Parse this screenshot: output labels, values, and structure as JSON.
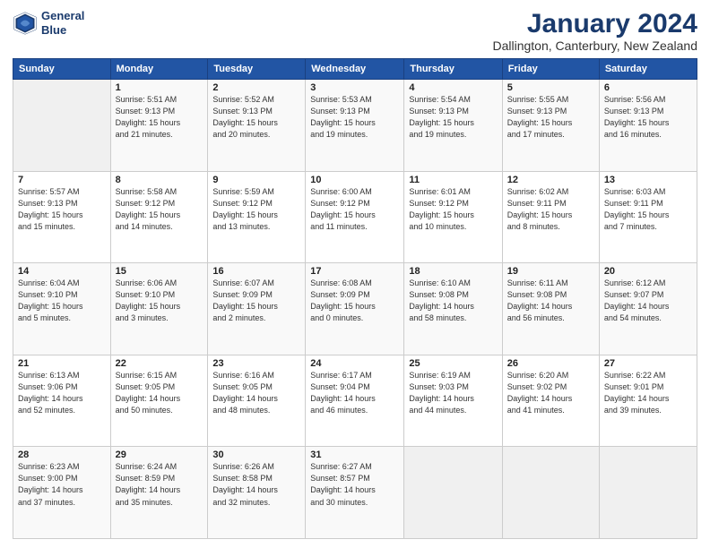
{
  "header": {
    "logo_line1": "General",
    "logo_line2": "Blue",
    "title": "January 2024",
    "subtitle": "Dallington, Canterbury, New Zealand"
  },
  "calendar": {
    "days_of_week": [
      "Sunday",
      "Monday",
      "Tuesday",
      "Wednesday",
      "Thursday",
      "Friday",
      "Saturday"
    ],
    "weeks": [
      [
        {
          "day": "",
          "info": ""
        },
        {
          "day": "1",
          "info": "Sunrise: 5:51 AM\nSunset: 9:13 PM\nDaylight: 15 hours\nand 21 minutes."
        },
        {
          "day": "2",
          "info": "Sunrise: 5:52 AM\nSunset: 9:13 PM\nDaylight: 15 hours\nand 20 minutes."
        },
        {
          "day": "3",
          "info": "Sunrise: 5:53 AM\nSunset: 9:13 PM\nDaylight: 15 hours\nand 19 minutes."
        },
        {
          "day": "4",
          "info": "Sunrise: 5:54 AM\nSunset: 9:13 PM\nDaylight: 15 hours\nand 19 minutes."
        },
        {
          "day": "5",
          "info": "Sunrise: 5:55 AM\nSunset: 9:13 PM\nDaylight: 15 hours\nand 17 minutes."
        },
        {
          "day": "6",
          "info": "Sunrise: 5:56 AM\nSunset: 9:13 PM\nDaylight: 15 hours\nand 16 minutes."
        }
      ],
      [
        {
          "day": "7",
          "info": "Sunrise: 5:57 AM\nSunset: 9:13 PM\nDaylight: 15 hours\nand 15 minutes."
        },
        {
          "day": "8",
          "info": "Sunrise: 5:58 AM\nSunset: 9:12 PM\nDaylight: 15 hours\nand 14 minutes."
        },
        {
          "day": "9",
          "info": "Sunrise: 5:59 AM\nSunset: 9:12 PM\nDaylight: 15 hours\nand 13 minutes."
        },
        {
          "day": "10",
          "info": "Sunrise: 6:00 AM\nSunset: 9:12 PM\nDaylight: 15 hours\nand 11 minutes."
        },
        {
          "day": "11",
          "info": "Sunrise: 6:01 AM\nSunset: 9:12 PM\nDaylight: 15 hours\nand 10 minutes."
        },
        {
          "day": "12",
          "info": "Sunrise: 6:02 AM\nSunset: 9:11 PM\nDaylight: 15 hours\nand 8 minutes."
        },
        {
          "day": "13",
          "info": "Sunrise: 6:03 AM\nSunset: 9:11 PM\nDaylight: 15 hours\nand 7 minutes."
        }
      ],
      [
        {
          "day": "14",
          "info": "Sunrise: 6:04 AM\nSunset: 9:10 PM\nDaylight: 15 hours\nand 5 minutes."
        },
        {
          "day": "15",
          "info": "Sunrise: 6:06 AM\nSunset: 9:10 PM\nDaylight: 15 hours\nand 3 minutes."
        },
        {
          "day": "16",
          "info": "Sunrise: 6:07 AM\nSunset: 9:09 PM\nDaylight: 15 hours\nand 2 minutes."
        },
        {
          "day": "17",
          "info": "Sunrise: 6:08 AM\nSunset: 9:09 PM\nDaylight: 15 hours\nand 0 minutes."
        },
        {
          "day": "18",
          "info": "Sunrise: 6:10 AM\nSunset: 9:08 PM\nDaylight: 14 hours\nand 58 minutes."
        },
        {
          "day": "19",
          "info": "Sunrise: 6:11 AM\nSunset: 9:08 PM\nDaylight: 14 hours\nand 56 minutes."
        },
        {
          "day": "20",
          "info": "Sunrise: 6:12 AM\nSunset: 9:07 PM\nDaylight: 14 hours\nand 54 minutes."
        }
      ],
      [
        {
          "day": "21",
          "info": "Sunrise: 6:13 AM\nSunset: 9:06 PM\nDaylight: 14 hours\nand 52 minutes."
        },
        {
          "day": "22",
          "info": "Sunrise: 6:15 AM\nSunset: 9:05 PM\nDaylight: 14 hours\nand 50 minutes."
        },
        {
          "day": "23",
          "info": "Sunrise: 6:16 AM\nSunset: 9:05 PM\nDaylight: 14 hours\nand 48 minutes."
        },
        {
          "day": "24",
          "info": "Sunrise: 6:17 AM\nSunset: 9:04 PM\nDaylight: 14 hours\nand 46 minutes."
        },
        {
          "day": "25",
          "info": "Sunrise: 6:19 AM\nSunset: 9:03 PM\nDaylight: 14 hours\nand 44 minutes."
        },
        {
          "day": "26",
          "info": "Sunrise: 6:20 AM\nSunset: 9:02 PM\nDaylight: 14 hours\nand 41 minutes."
        },
        {
          "day": "27",
          "info": "Sunrise: 6:22 AM\nSunset: 9:01 PM\nDaylight: 14 hours\nand 39 minutes."
        }
      ],
      [
        {
          "day": "28",
          "info": "Sunrise: 6:23 AM\nSunset: 9:00 PM\nDaylight: 14 hours\nand 37 minutes."
        },
        {
          "day": "29",
          "info": "Sunrise: 6:24 AM\nSunset: 8:59 PM\nDaylight: 14 hours\nand 35 minutes."
        },
        {
          "day": "30",
          "info": "Sunrise: 6:26 AM\nSunset: 8:58 PM\nDaylight: 14 hours\nand 32 minutes."
        },
        {
          "day": "31",
          "info": "Sunrise: 6:27 AM\nSunset: 8:57 PM\nDaylight: 14 hours\nand 30 minutes."
        },
        {
          "day": "",
          "info": ""
        },
        {
          "day": "",
          "info": ""
        },
        {
          "day": "",
          "info": ""
        }
      ]
    ]
  }
}
